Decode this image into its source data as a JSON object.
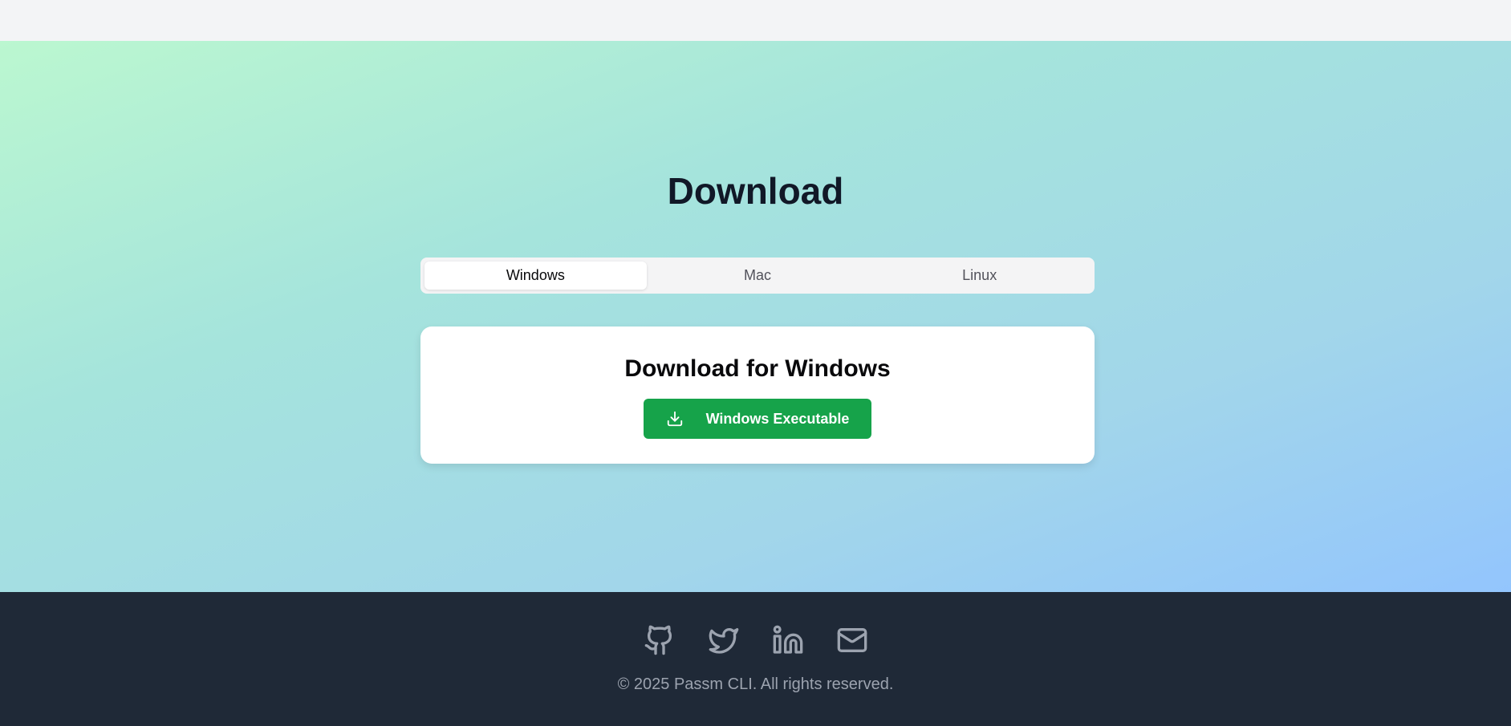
{
  "download": {
    "title": "Download",
    "tabs": [
      {
        "label": "Windows",
        "active": true
      },
      {
        "label": "Mac",
        "active": false
      },
      {
        "label": "Linux",
        "active": false
      }
    ],
    "card": {
      "title": "Download for Windows",
      "button_label": "Windows Executable",
      "button_icon": "download-icon",
      "button_color": "#16a34a"
    }
  },
  "footer": {
    "social_icons": [
      "github-icon",
      "twitter-icon",
      "linkedin-icon",
      "mail-icon"
    ],
    "copyright": "© 2025 Passm CLI. All rights reserved."
  },
  "colors": {
    "topbar": "#f3f4f6",
    "footer": "#1f2937",
    "gradient_start": "#bbf7d0",
    "gradient_end": "#93c5fd"
  }
}
